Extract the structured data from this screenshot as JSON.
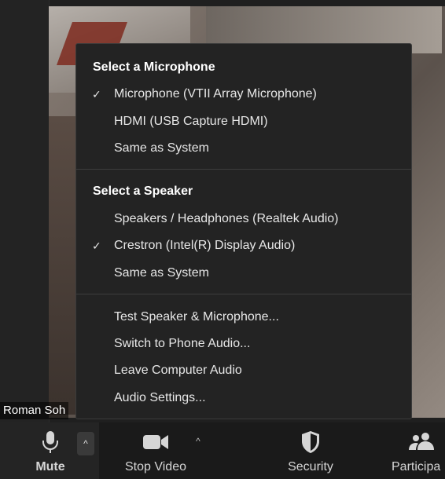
{
  "video": {
    "participant_name": "Roman Soh"
  },
  "audio_menu": {
    "microphone_header": "Select a Microphone",
    "microphones": [
      {
        "label": "Microphone (VTII Array Microphone)",
        "checked": true
      },
      {
        "label": "HDMI (USB Capture HDMI)",
        "checked": false
      },
      {
        "label": "Same as System",
        "checked": false
      }
    ],
    "speaker_header": "Select a Speaker",
    "speakers": [
      {
        "label": "Speakers / Headphones (Realtek Audio)",
        "checked": false
      },
      {
        "label": "Crestron (Intel(R) Display Audio)",
        "checked": true
      },
      {
        "label": "Same as System",
        "checked": false
      }
    ],
    "actions": [
      {
        "label": "Test Speaker & Microphone..."
      },
      {
        "label": "Switch to Phone Audio..."
      },
      {
        "label": "Leave Computer Audio"
      },
      {
        "label": "Audio Settings..."
      }
    ],
    "check_glyph": "✓"
  },
  "toolbar": {
    "mute_label": "Mute",
    "stop_video_label": "Stop Video",
    "security_label": "Security",
    "participants_label": "Participa",
    "caret_glyph": "^"
  },
  "colors": {
    "menu_bg": "#232323",
    "toolbar_bg": "#1a1a1a",
    "text": "#e7e7e7"
  }
}
